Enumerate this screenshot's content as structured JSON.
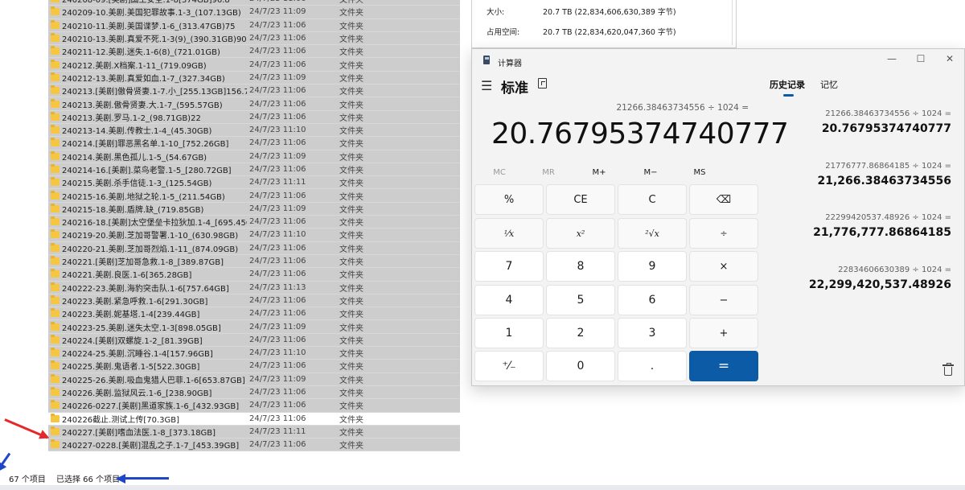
{
  "explorer": {
    "files": [
      {
        "name": "240208-09.[美剧]国土安全.1-8[374GB]96.8",
        "date": "24/7/23 11:06",
        "type": "文件夹",
        "selected": true
      },
      {
        "name": "240209-10.美剧.美国犯罪故事.1-3_(107.13GB)",
        "date": "24/7/23 11:09",
        "type": "文件夹",
        "selected": true
      },
      {
        "name": "240210-11.美剧.美国谍梦.1-6_(313.47GB)75",
        "date": "24/7/23 11:06",
        "type": "文件夹",
        "selected": true
      },
      {
        "name": "240210-13.美剧.真爱不死.1-3(9)_(390.31GB)90",
        "date": "24/7/23 11:06",
        "type": "文件夹",
        "selected": true
      },
      {
        "name": "240211-12.美剧.迷失.1-6(8)_(721.01GB)",
        "date": "24/7/23 11:06",
        "type": "文件夹",
        "selected": true
      },
      {
        "name": "240212.美剧.X档案.1-11_(719.09GB)",
        "date": "24/7/23 11:06",
        "type": "文件夹",
        "selected": true
      },
      {
        "name": "240212-13.美剧.真爱如血.1-7_(327.34GB)",
        "date": "24/7/23 11:09",
        "type": "文件夹",
        "selected": true
      },
      {
        "name": "240213.[美剧]傲骨贤妻.1-7.小_[255.13GB]156.7",
        "date": "24/7/23 11:06",
        "type": "文件夹",
        "selected": true
      },
      {
        "name": "240213.美剧.傲骨贤妻.大.1-7_(595.57GB)",
        "date": "24/7/23 11:06",
        "type": "文件夹",
        "selected": true
      },
      {
        "name": "240213.美剧.罗马.1-2_(98.71GB)22",
        "date": "24/7/23 11:06",
        "type": "文件夹",
        "selected": true
      },
      {
        "name": "240213-14.美剧.传教士.1-4_(45.30GB)",
        "date": "24/7/23 11:10",
        "type": "文件夹",
        "selected": true
      },
      {
        "name": "240214.[美剧]罪恶黑名单.1-10_[752.26GB]",
        "date": "24/7/23 11:06",
        "type": "文件夹",
        "selected": true
      },
      {
        "name": "240214.美剧.黑色孤儿.1-5_(54.67GB)",
        "date": "24/7/23 11:09",
        "type": "文件夹",
        "selected": true
      },
      {
        "name": "240214-16.[美剧].菜鸟老警.1-5_[280.72GB]",
        "date": "24/7/23 11:06",
        "type": "文件夹",
        "selected": true
      },
      {
        "name": "240215.美剧.杀手信徒.1-3_(125.54GB)",
        "date": "24/7/23 11:11",
        "type": "文件夹",
        "selected": true
      },
      {
        "name": "240215-16.美剧.地狱之轮.1-5_(211.54GB)",
        "date": "24/7/23 11:06",
        "type": "文件夹",
        "selected": true
      },
      {
        "name": "240215-18.美剧.盾牌.缺_(719.85GB)",
        "date": "24/7/23 11:09",
        "type": "文件夹",
        "selected": true
      },
      {
        "name": "240216-18.[美剧]太空堡垒卡拉狄加.1-4_[695.45GB]",
        "date": "24/7/23 11:06",
        "type": "文件夹",
        "selected": true
      },
      {
        "name": "240219-20.美剧.芝加哥警署.1-10_(630.98GB)",
        "date": "24/7/23 11:10",
        "type": "文件夹",
        "selected": true
      },
      {
        "name": "240220-21.美剧.芝加哥烈焰.1-11_(874.09GB)",
        "date": "24/7/23 11:06",
        "type": "文件夹",
        "selected": true
      },
      {
        "name": "240221.[美剧]芝加哥急救.1-8_[389.87GB]",
        "date": "24/7/23 11:06",
        "type": "文件夹",
        "selected": true
      },
      {
        "name": "240221.美剧.良医.1-6[365.28GB]",
        "date": "24/7/23 11:06",
        "type": "文件夹",
        "selected": true
      },
      {
        "name": "240222-23.美剧.海豹突击队.1-6[757.64GB]",
        "date": "24/7/23 11:13",
        "type": "文件夹",
        "selected": true
      },
      {
        "name": "240223.美剧.紧急呼救.1-6[291.30GB]",
        "date": "24/7/23 11:06",
        "type": "文件夹",
        "selected": true
      },
      {
        "name": "240223.美剧.妮基塔.1-4[239.44GB]",
        "date": "24/7/23 11:06",
        "type": "文件夹",
        "selected": true
      },
      {
        "name": "240223-25.美剧.迷失太空.1-3[898.05GB]",
        "date": "24/7/23 11:09",
        "type": "文件夹",
        "selected": true
      },
      {
        "name": "240224.[美剧]双螺旋.1-2_[81.39GB]",
        "date": "24/7/23 11:06",
        "type": "文件夹",
        "selected": true
      },
      {
        "name": "240224-25.美剧.沉睡谷.1-4[157.96GB]",
        "date": "24/7/23 11:10",
        "type": "文件夹",
        "selected": true
      },
      {
        "name": "240225.美剧.鬼语者.1-5[522.30GB]",
        "date": "24/7/23 11:06",
        "type": "文件夹",
        "selected": true
      },
      {
        "name": "240225-26.美剧.吸血鬼猎人巴菲.1-6[653.87GB]",
        "date": "24/7/23 11:09",
        "type": "文件夹",
        "selected": true
      },
      {
        "name": "240226.美剧.监狱风云.1-6_[238.90GB]",
        "date": "24/7/23 11:06",
        "type": "文件夹",
        "selected": true
      },
      {
        "name": "240226-0227.[美剧]黑道家族.1-6_[432.93GB]",
        "date": "24/7/23 11:06",
        "type": "文件夹",
        "selected": true
      },
      {
        "name": "240226截止.测试上传[70.3GB]",
        "date": "24/7/23 11:06",
        "type": "文件夹",
        "selected": false
      },
      {
        "name": "240227.[美剧]嗜血法医.1-8_[373.18GB]",
        "date": "24/7/23 11:11",
        "type": "文件夹",
        "selected": true
      },
      {
        "name": "240227-0228.[美剧]混乱之子.1-7_[453.39GB]",
        "date": "24/7/23 11:06",
        "type": "文件夹",
        "selected": true
      }
    ],
    "status_count": "67 个项目",
    "status_selected": "已选择 66 个项目"
  },
  "properties": {
    "size_label": "大小:",
    "size_value": "20.7 TB (22,834,606,630,389 字节)",
    "disk_label": "占用空间:",
    "disk_value": "20.7 TB (22,834,620,047,360 字节)"
  },
  "calculator": {
    "window_title": "计算器",
    "mode": "标准",
    "expression": "21266.38463734556 ÷ 1024 =",
    "display": "20.76795374740777",
    "memory_buttons": [
      "MC",
      "MR",
      "M+",
      "M−",
      "MS"
    ],
    "keys": [
      [
        "%",
        "CE",
        "C",
        "⌫"
      ],
      [
        "¹⁄x",
        "x²",
        "²√x",
        "÷"
      ],
      [
        "7",
        "8",
        "9",
        "×"
      ],
      [
        "4",
        "5",
        "6",
        "−"
      ],
      [
        "1",
        "2",
        "3",
        "+"
      ],
      [
        "⁺⁄₋",
        "0",
        ".",
        "="
      ]
    ],
    "history_tab": "历史记录",
    "memory_tab": "记忆",
    "history": [
      {
        "expr": "21266.38463734556  ÷  1024 =",
        "result": "20.76795374740777"
      },
      {
        "expr": "21776777.86864185  ÷  1024 =",
        "result": "21,266.38463734556"
      },
      {
        "expr": "22299420537.48926  ÷  1024 =",
        "result": "21,776,777.86864185"
      },
      {
        "expr": "22834606630389  ÷  1024 =",
        "result": "22,299,420,537.48926"
      }
    ],
    "accent_color": "#0c5ba6"
  }
}
